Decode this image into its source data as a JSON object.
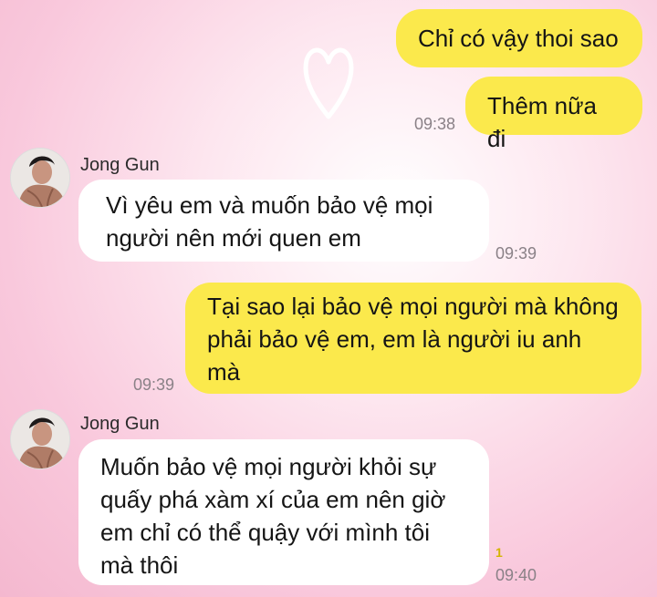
{
  "decoration": {
    "heart_icon": "heart-outline-icon",
    "heart_color": "#ffffff"
  },
  "messages": [
    {
      "sender": "me",
      "text": "Chỉ có vậy thoi sao"
    },
    {
      "sender": "me",
      "text": "Thêm nữa đi",
      "time": "09:38"
    },
    {
      "sender": "them",
      "name": "Jong Gun",
      "text": "Vì yêu em và muốn bảo vệ mọi người nên mới quen em",
      "time": "09:39"
    },
    {
      "sender": "me",
      "text": "Tại sao lại bảo vệ mọi người mà không phải bảo vệ em, em là người iu anh mà",
      "time": "09:39"
    },
    {
      "sender": "them",
      "name": "Jong Gun",
      "text": "Muốn bảo vệ mọi người khỏi sự quấy phá xàm xí của em nên giờ em chỉ có thể quậy với mình tôi mà thôi",
      "time": "09:40",
      "reaction_count": "1"
    }
  ],
  "colors": {
    "my_bubble": "#fbe94c",
    "their_bubble": "#ffffff",
    "timestamp": "#8a8187"
  }
}
